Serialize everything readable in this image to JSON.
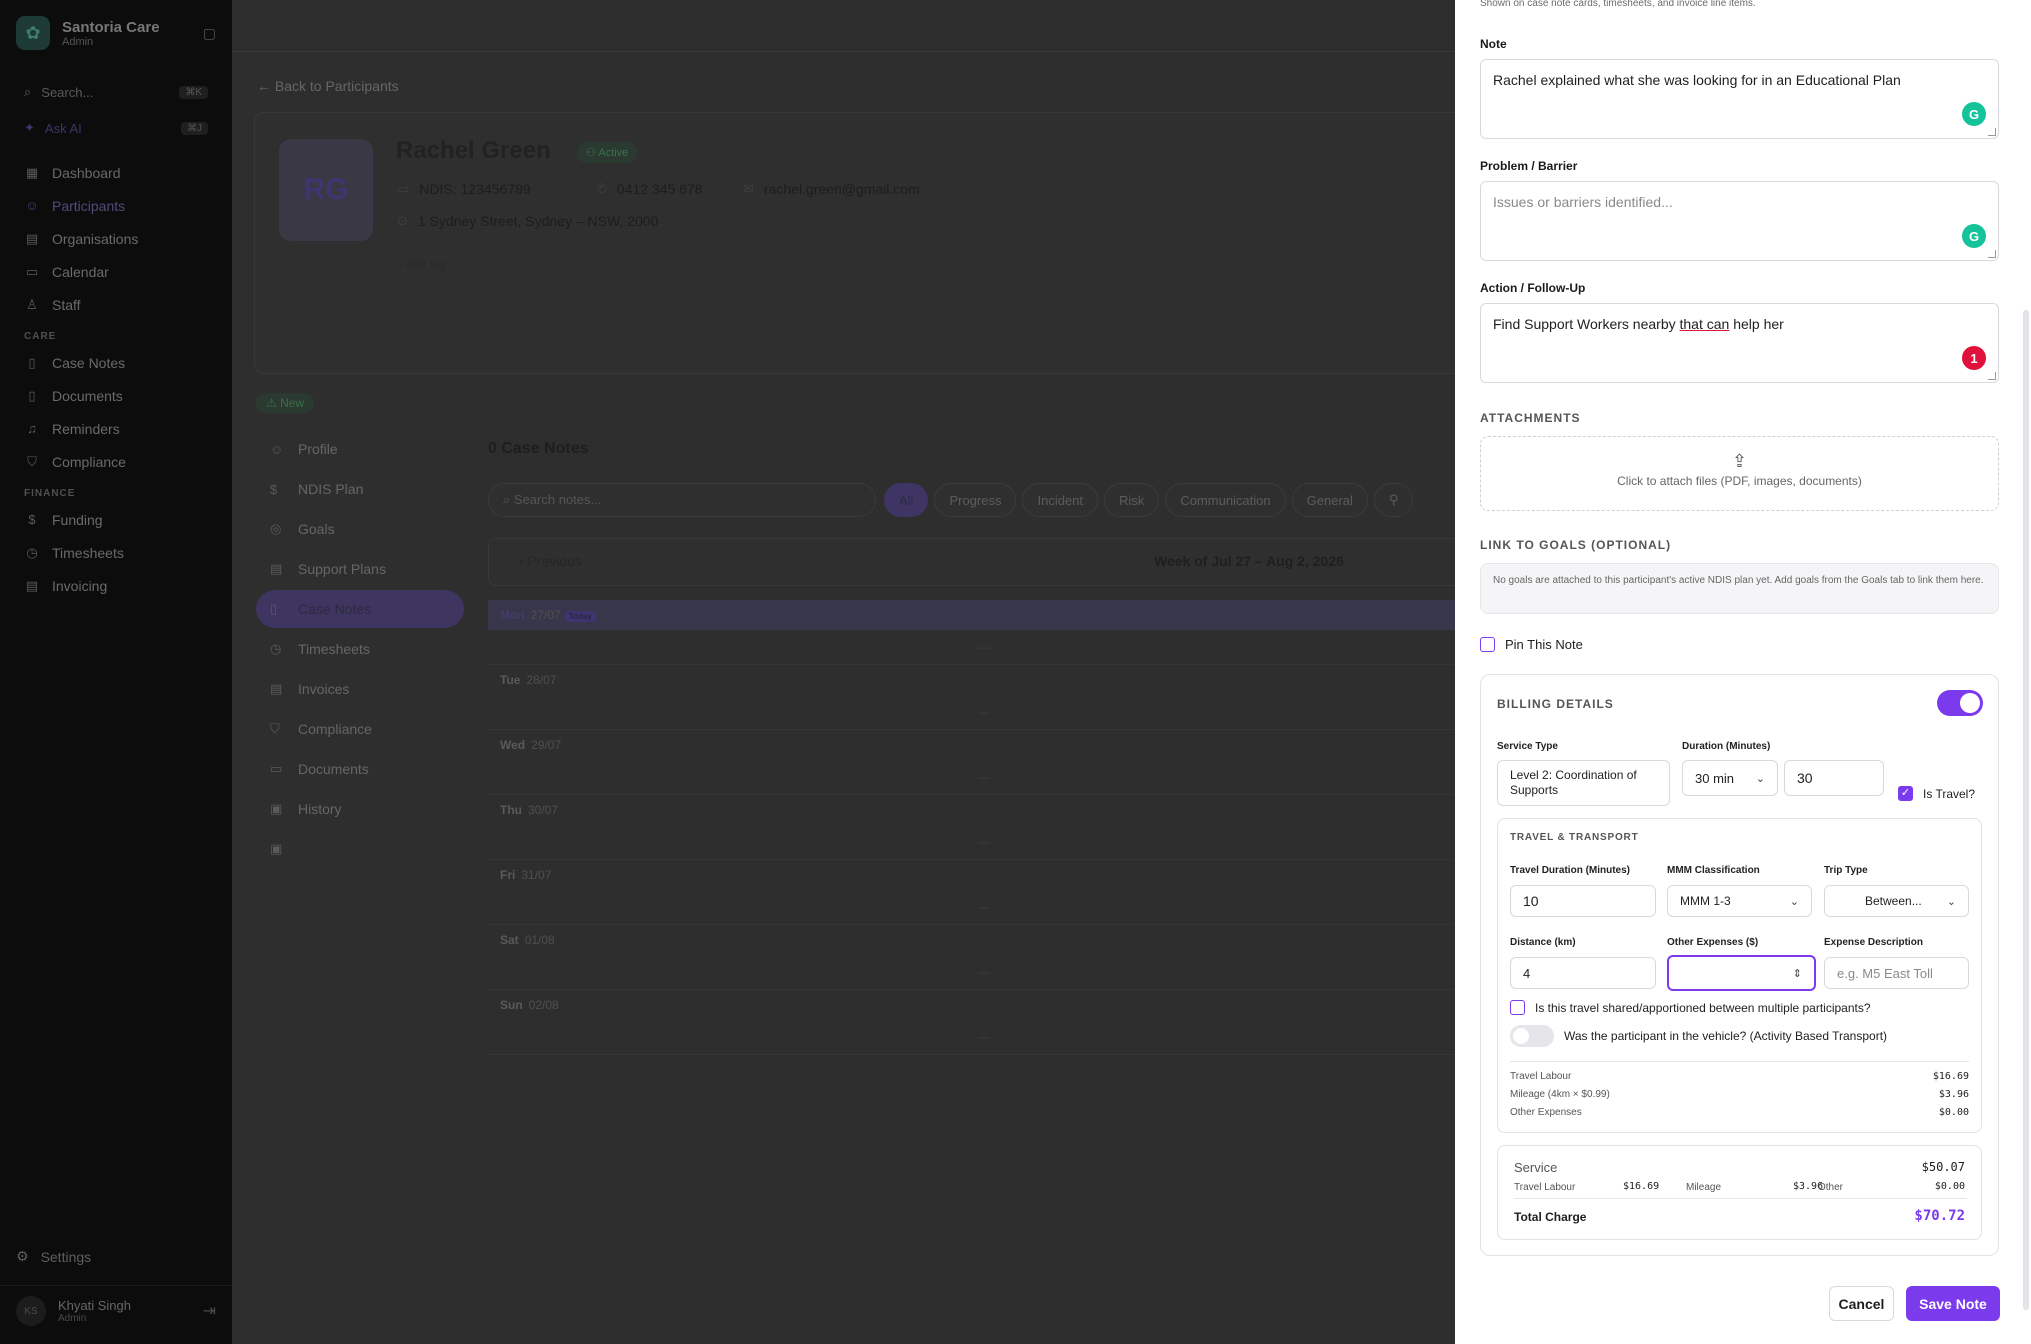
{
  "sidebar": {
    "brand_name": "Santoria Care",
    "brand_role": "Admin",
    "search_placeholder": "Search...",
    "search_kbd": "⌘K",
    "ask_ai": "Ask AI",
    "ask_ai_kbd": "⌘J",
    "nav_main": [
      "Dashboard",
      "Participants",
      "Organisations",
      "Calendar",
      "Staff"
    ],
    "care_section": "CARE",
    "nav_care": [
      "Case Notes",
      "Documents",
      "Reminders",
      "Compliance"
    ],
    "finance_section": "FINANCE",
    "nav_finance": [
      "Funding",
      "Timesheets",
      "Invoicing"
    ],
    "settings": "Settings",
    "user_initials": "KS",
    "user_name": "Khyati Singh",
    "user_role": "Admin"
  },
  "main": {
    "back_link": "Back to Participants",
    "avatar_initials": "RG",
    "participant_name": "Rachel Green",
    "status": "Active",
    "ndis": "NDIS: 123456789",
    "phone": "0412 345 678",
    "email": "rachel.green@gmail.com",
    "address": "1 Sydney Street, Sydney – NSW, 2000",
    "add_tag": "Add Tag",
    "new_badge": "New",
    "tabs": [
      "Profile",
      "NDIS Plan",
      "Goals",
      "Support Plans",
      "Case Notes",
      "Timesheets",
      "Invoices",
      "Compliance",
      "Documents",
      "History"
    ],
    "case_notes_title": "0 Case Notes",
    "search_notes_placeholder": "Search notes...",
    "filters": [
      "All",
      "Progress",
      "Incident",
      "Risk",
      "Communication",
      "General"
    ],
    "previous": "Previous",
    "week_label": "Week of Jul 27 – Aug 2, 2026",
    "today_badge": "Today",
    "days": [
      {
        "name": "Mon",
        "date": "27/07",
        "dash": "—"
      },
      {
        "name": "Tue",
        "date": "28/07",
        "dash": "—"
      },
      {
        "name": "Wed",
        "date": "29/07",
        "dash": "—"
      },
      {
        "name": "Thu",
        "date": "30/07",
        "dash": "—"
      },
      {
        "name": "Fri",
        "date": "31/07",
        "dash": "—"
      },
      {
        "name": "Sat",
        "date": "01/08",
        "dash": "—"
      },
      {
        "name": "Sun",
        "date": "02/08",
        "dash": "—"
      }
    ]
  },
  "drawer": {
    "hint": "Shown on case note cards, timesheets, and invoice line items.",
    "note_label": "Note",
    "note_value": "Rachel explained what she was looking for in an Educational Plan",
    "problem_label": "Problem / Barrier",
    "problem_placeholder": "Issues or barriers identified...",
    "action_label": "Action / Follow-Up",
    "action_value_a": "Find Support Workers nearby ",
    "action_value_b": "that can",
    "action_value_c": " help her",
    "grammarly_count": "1",
    "attachments_title": "ATTACHMENTS",
    "attach_text": "Click to attach files (PDF, images, documents)",
    "goals_title": "LINK TO GOALS (OPTIONAL)",
    "goals_text": "No goals are attached to this participant's active NDIS plan yet. Add goals from the Goals tab to link them here.",
    "pin_label": "Pin This Note",
    "billing_title": "BILLING DETAILS",
    "service_type_label": "Service Type",
    "service_type_value": "Level 2: Coordination of Supports",
    "duration_label": "Duration (Minutes)",
    "duration_select": "30 min",
    "duration_value": "30",
    "is_travel_label": "Is Travel?",
    "travel_title": "TRAVEL & TRANSPORT",
    "travel_duration_label": "Travel Duration (Minutes)",
    "travel_duration_value": "10",
    "mmm_label": "MMM Classification",
    "mmm_value": "MMM 1-3",
    "trip_label": "Trip Type",
    "trip_value": "Between...",
    "distance_label": "Distance (km)",
    "distance_value": "4",
    "other_exp_label": "Other Expenses ($)",
    "other_exp_value": "",
    "exp_desc_label": "Expense Description",
    "exp_desc_placeholder": "e.g. M5 East Toll",
    "shared_label": "Is this travel shared/apportioned between multiple participants?",
    "in_vehicle_label": "Was the participant in the vehicle? (Activity Based Transport)",
    "travel_labour_label": "Travel Labour",
    "travel_labour_value": "$16.69",
    "mileage_label": "Mileage (4km × $0.99)",
    "mileage_value": "$3.96",
    "other_expenses_label": "Other Expenses",
    "other_expenses_value": "$0.00",
    "service_label": "Service",
    "service_value": "$50.07",
    "sum_travel_labour_label": "Travel Labour",
    "sum_travel_labour_value": "$16.69",
    "sum_mileage_label": "Mileage",
    "sum_mileage_value": "$3.96",
    "sum_other_label": "Other",
    "sum_other_value": "$0.00",
    "total_label": "Total Charge",
    "total_value": "$70.72",
    "cancel": "Cancel",
    "save": "Save Note"
  },
  "colors": {
    "accent": "#7c3aed",
    "grammarly": "#15c39a",
    "grammarly_alert": "#e0113b"
  }
}
